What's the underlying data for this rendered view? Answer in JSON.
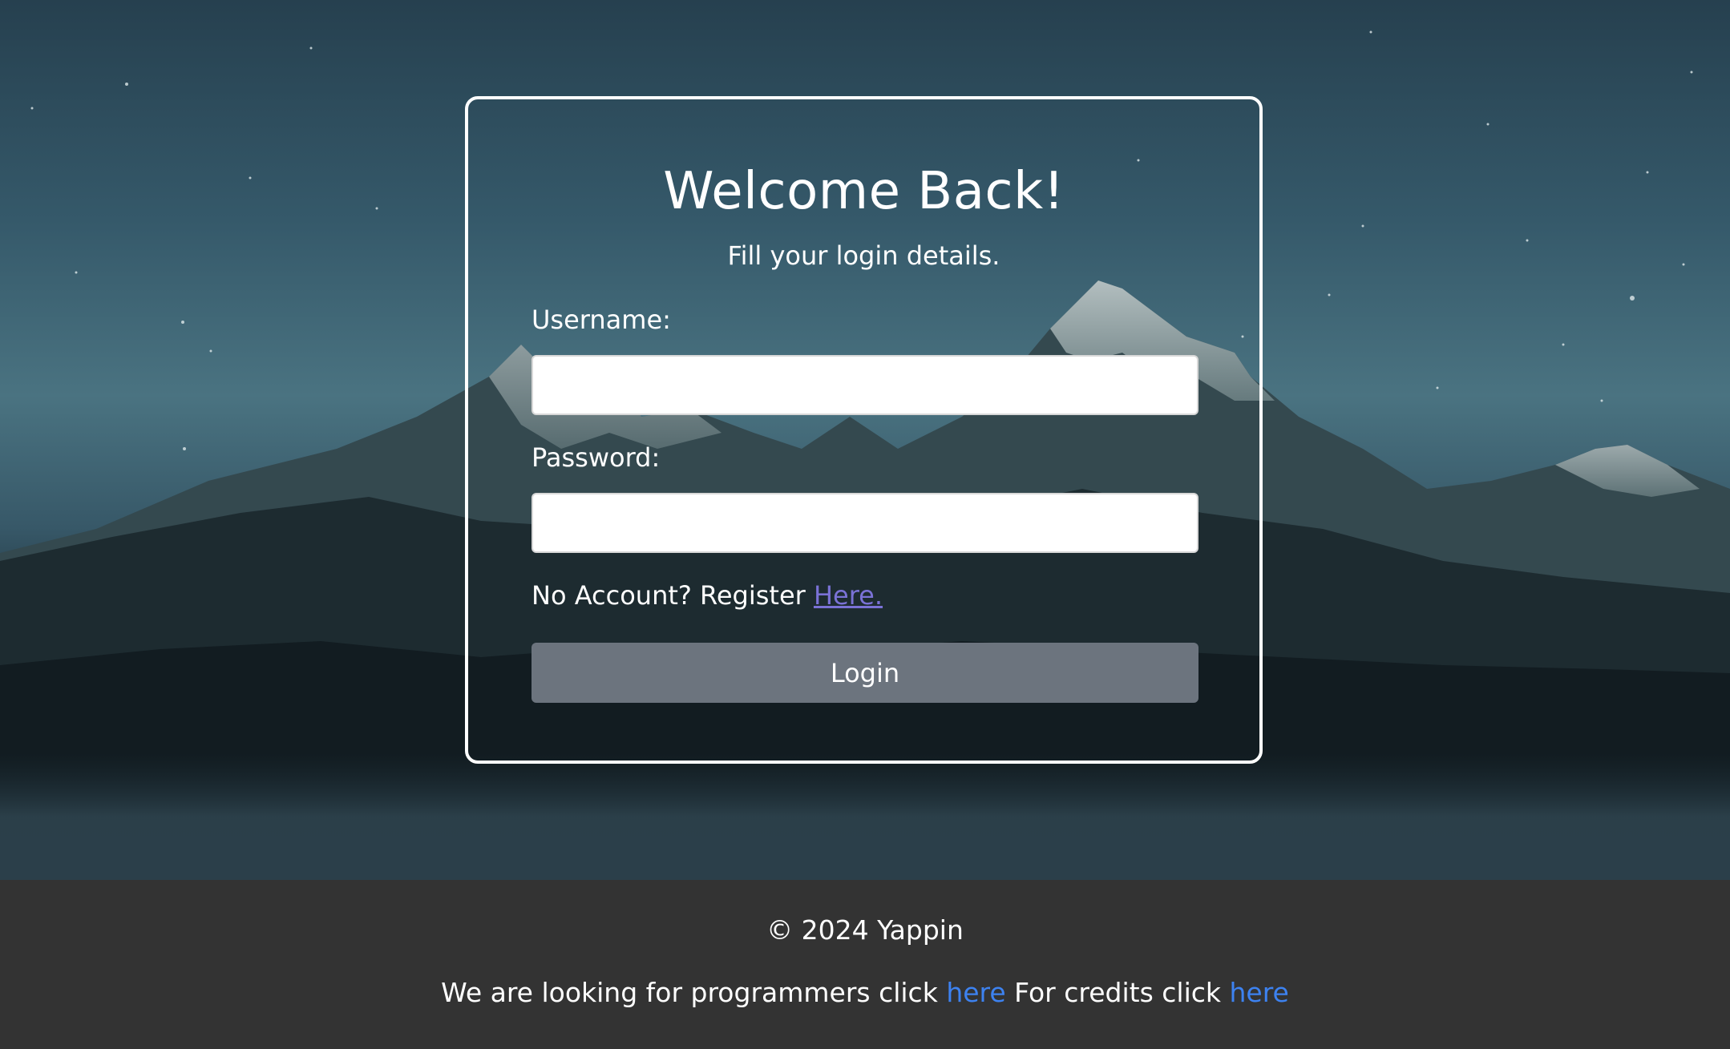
{
  "login": {
    "title": "Welcome Back!",
    "subtitle": "Fill your login details.",
    "username_label": "Username:",
    "username_value": "",
    "password_label": "Password:",
    "password_value": "",
    "register_prefix": "No Account? Register ",
    "register_link": "Here.",
    "login_button": "Login"
  },
  "footer": {
    "copyright": "© 2024 Yappin",
    "programmers_text": "We are looking for programmers click ",
    "programmers_link": "here",
    "credits_text": " For credits click ",
    "credits_link": "here"
  },
  "colors": {
    "card_border": "#ffffff",
    "input_bg": "#ffffff",
    "button_bg": "#6c747e",
    "register_link": "#7a72d6",
    "footer_bg": "#333333",
    "footer_link": "#3d82f0"
  }
}
